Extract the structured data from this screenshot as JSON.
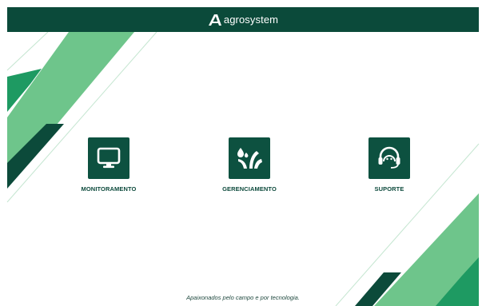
{
  "header": {
    "brand": "agrosystem",
    "logo_icon": "agrosystem-logo-icon"
  },
  "menu": {
    "items": [
      {
        "label": "MONITORAMENTO",
        "icon": "monitor-icon"
      },
      {
        "label": "GERENCIAMENTO",
        "icon": "plant-water-icon"
      },
      {
        "label": "SUPORTE",
        "icon": "headset-support-icon"
      }
    ]
  },
  "footer": {
    "tagline": "Apaixonados pelo campo e por tecnologia."
  },
  "colors": {
    "header_bg": "#0b4a3a",
    "tile_bg": "#0d5140",
    "accent_light_green": "#6cc58a",
    "accent_mid_green": "#1f9c63",
    "accent_dark_green": "#0c4a3a"
  }
}
